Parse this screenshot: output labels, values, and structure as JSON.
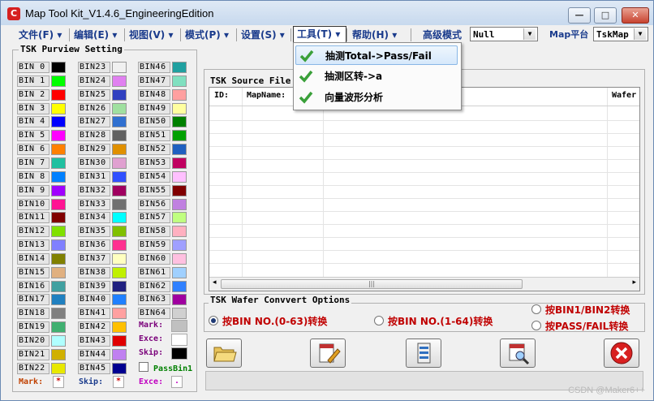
{
  "window": {
    "title": "Map Tool Kit_V1.4.6_EngineeringEdition",
    "app_icon_letter": "C",
    "minimize": "—",
    "maximize": "□",
    "close": "✕"
  },
  "menu": {
    "items": [
      "文件(F)",
      "编辑(E)",
      "视图(V)",
      "模式(P)",
      "设置(S)",
      "工具(T)",
      "帮助(H)"
    ],
    "mode_label": "高级模式",
    "mode_value": "Null",
    "platform_label": "Map平台",
    "platform_value": "TskMap"
  },
  "tools_menu": {
    "items": [
      "抽测Total->Pass/Fail",
      "抽测区转->a",
      "向量波形分析"
    ]
  },
  "purview": {
    "title": "TSK Purview Setting",
    "col1": [
      {
        "label": "BIN 0",
        "color": "#000000"
      },
      {
        "label": "BIN 1",
        "color": "#00ff00"
      },
      {
        "label": "BIN 2",
        "color": "#ff0000"
      },
      {
        "label": "BIN 3",
        "color": "#ffff00"
      },
      {
        "label": "BIN 4",
        "color": "#0000ff"
      },
      {
        "label": "BIN 5",
        "color": "#ff00ff"
      },
      {
        "label": "BIN 6",
        "color": "#ff8000"
      },
      {
        "label": "BIN 7",
        "color": "#20c0a0"
      },
      {
        "label": "BIN 8",
        "color": "#0080ff"
      },
      {
        "label": "BIN 9",
        "color": "#a000ff"
      },
      {
        "label": "BIN10",
        "color": "#ff1493"
      },
      {
        "label": "BIN11",
        "color": "#800000"
      },
      {
        "label": "BIN12",
        "color": "#80e000"
      },
      {
        "label": "BIN13",
        "color": "#8080ff"
      },
      {
        "label": "BIN14",
        "color": "#808000"
      },
      {
        "label": "BIN15",
        "color": "#e0b080"
      },
      {
        "label": "BIN16",
        "color": "#40a0a0"
      },
      {
        "label": "BIN17",
        "color": "#2080c0"
      },
      {
        "label": "BIN18",
        "color": "#808080"
      },
      {
        "label": "BIN19",
        "color": "#40b070"
      },
      {
        "label": "BIN20",
        "color": "#b0ffff"
      },
      {
        "label": "BIN21",
        "color": "#d0b000"
      },
      {
        "label": "BIN22",
        "color": "#e8e800"
      }
    ],
    "col2": [
      {
        "label": "BIN23",
        "color": "#f0f0f0"
      },
      {
        "label": "BIN24",
        "color": "#e080f0"
      },
      {
        "label": "BIN25",
        "color": "#3040c0"
      },
      {
        "label": "BIN26",
        "color": "#a0e0a0"
      },
      {
        "label": "BIN27",
        "color": "#3070d0"
      },
      {
        "label": "BIN28",
        "color": "#606060"
      },
      {
        "label": "BIN29",
        "color": "#e09000"
      },
      {
        "label": "BIN30",
        "color": "#e0a0d0"
      },
      {
        "label": "BIN31",
        "color": "#3050ff"
      },
      {
        "label": "BIN32",
        "color": "#a00060"
      },
      {
        "label": "BIN33",
        "color": "#707070"
      },
      {
        "label": "BIN34",
        "color": "#00ffff"
      },
      {
        "label": "BIN35",
        "color": "#80c000"
      },
      {
        "label": "BIN36",
        "color": "#ff3090"
      },
      {
        "label": "BIN37",
        "color": "#ffffc0"
      },
      {
        "label": "BIN38",
        "color": "#c0f000"
      },
      {
        "label": "BIN39",
        "color": "#202080"
      },
      {
        "label": "BIN40",
        "color": "#2080ff"
      },
      {
        "label": "BIN41",
        "color": "#ffa0a0"
      },
      {
        "label": "BIN42",
        "color": "#ffc000"
      },
      {
        "label": "BIN43",
        "color": "#e00000"
      },
      {
        "label": "BIN44",
        "color": "#c080f0"
      },
      {
        "label": "BIN45",
        "color": "#000090"
      }
    ],
    "col3": [
      {
        "label": "BIN46",
        "color": "#20a0a0"
      },
      {
        "label": "BIN47",
        "color": "#80e0c0"
      },
      {
        "label": "BIN48",
        "color": "#ffa0a0"
      },
      {
        "label": "BIN49",
        "color": "#ffffa0"
      },
      {
        "label": "BIN50",
        "color": "#008000"
      },
      {
        "label": "BIN51",
        "color": "#00a000"
      },
      {
        "label": "BIN52",
        "color": "#2060c0"
      },
      {
        "label": "BIN53",
        "color": "#c00060"
      },
      {
        "label": "BIN54",
        "color": "#ffc0ff"
      },
      {
        "label": "BIN55",
        "color": "#800000"
      },
      {
        "label": "BIN56",
        "color": "#c080e0"
      },
      {
        "label": "BIN57",
        "color": "#c0ff80"
      },
      {
        "label": "BIN58",
        "color": "#ffb0c0"
      },
      {
        "label": "BIN59",
        "color": "#a0a0ff"
      },
      {
        "label": "BIN60",
        "color": "#ffc0e0"
      },
      {
        "label": "BIN61",
        "color": "#a0d0ff"
      },
      {
        "label": "BIN62",
        "color": "#3080ff"
      },
      {
        "label": "BIN63",
        "color": "#a000a0"
      },
      {
        "label": "BIN64",
        "color": "#d0d0d0"
      }
    ],
    "mark_label": "Mark:",
    "mark_color": "#c0c0c0",
    "exce_label": "Exce:",
    "exce_color": "#ffffff",
    "skip_label": "Skip:",
    "skip_color": "#000000",
    "passbin_label": "PassBin1",
    "bottom": {
      "mark_label": "Mark:",
      "mark_value": "*",
      "skip_label": "Skip:",
      "skip_value": "*",
      "exce_label": "Exce:",
      "exce_value": "."
    }
  },
  "source": {
    "title": "TSK Source File",
    "headers": [
      "ID:",
      "MapName:",
      "Wafer"
    ]
  },
  "convert": {
    "title": "TSK Wafer Convvert Options",
    "options": [
      "按BIN NO.(0-63)转换",
      "按BIN NO.(1-64)转换",
      "按BIN1/BIN2转换",
      "按PASS/FAIL转换"
    ]
  },
  "watermark": "CSDN @Maker6++"
}
